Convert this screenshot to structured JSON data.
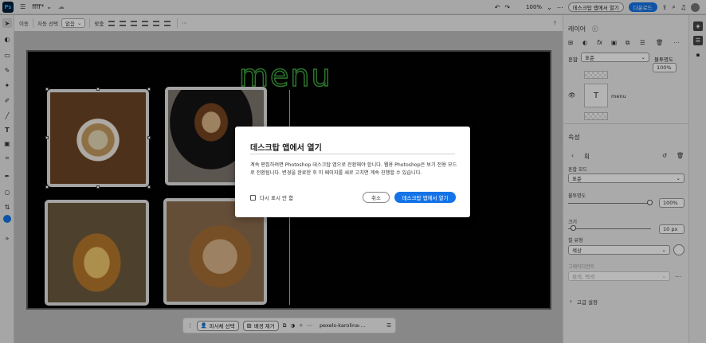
{
  "topbar": {
    "app_logo": "Ps",
    "doc_name": "ffff*",
    "zoom": "100%",
    "open_desktop_label": "데스크탑 앱에서 열기",
    "download_label": "다운로드"
  },
  "options": {
    "move_label": "이동",
    "auto_select_label": "자동 선택",
    "select_value": "없음",
    "align_label": "맞춤"
  },
  "canvas": {
    "menu_title": "menu"
  },
  "layers_panel": {
    "title": "레이어",
    "blend_label": "혼합",
    "blend_value": "표준",
    "opacity_label": "불투명도",
    "opacity_value": "100%",
    "layer_name": "menu"
  },
  "properties_panel": {
    "title": "속성",
    "section": "획",
    "blend_mode_label": "혼합 모드",
    "blend_mode_value": "표준",
    "opacity_label": "불투명도",
    "opacity_value": "100%",
    "size_label": "크기",
    "size_value": "10 px",
    "fill_type_label": "칠 유형",
    "fill_type_value": "색상",
    "gradient_label": "그레이디언트",
    "gradient_value": "흰색, 백색",
    "advanced_label": "고급 설정"
  },
  "bottombar": {
    "select_subject_label": "피사체 선택",
    "remove_bg_label": "배경 제거",
    "file_label": "pexels-karolina-..."
  },
  "dialog": {
    "title": "데스크탑 앱에서 열기",
    "body": "계속 편집하려면 Photoshop 데스크탑 앱으로 전환해야 합니다. 웹용 Photoshop은 보기 전용 모드로 전환됩니다. 변경을 완료한 후 이 페이지를 새로 고치면 계속 진행할 수 있습니다.",
    "dont_show_label": "다시 표시 안 함",
    "cancel_label": "취소",
    "open_label": "데스크탑 앱에서 열기"
  },
  "colors": {
    "accent": "#1473e6",
    "neon": "#3ea33e"
  }
}
